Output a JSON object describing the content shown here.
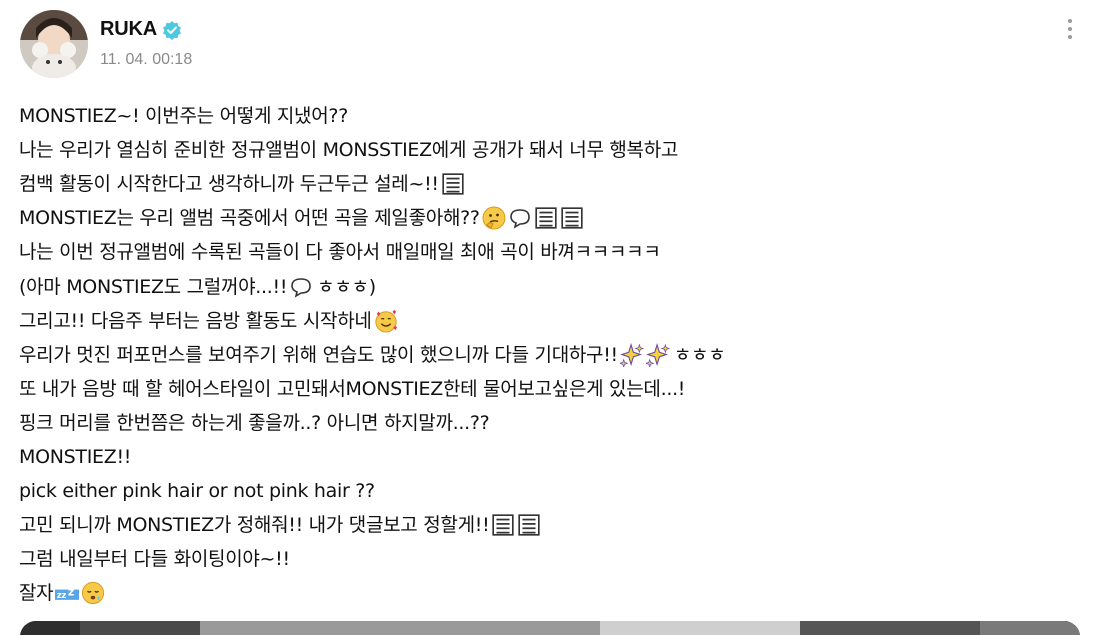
{
  "post": {
    "author": "RUKA",
    "timestamp": "11. 04. 00:18",
    "more_label": "more options"
  },
  "text_lines": [
    {
      "text": "MONSTIEZ~! 이번주는 어떻게 지냈어??",
      "icons": []
    },
    {
      "text": "나는 우리가 열심히 준비한 정규앨범이 MONSSTIEZ에게 공개가 돼서 너무 행복하고",
      "icons": []
    },
    {
      "text": "컴백 활동이 시작한다고 생각하니까 두근두근 설레~!!",
      "icons": [
        "notepad-icon"
      ]
    },
    {
      "text": "MONSTIEZ는 우리 앨범 곡중에서 어떤 곡을 제일좋아해??",
      "icons": [
        "thinking-face-icon",
        "speech-bubble-icon",
        "notepad-icon",
        "notepad-icon"
      ]
    },
    {
      "text": "나는 이번 정규앨범에 수록된 곡들이 다 좋아서 매일매일 최애 곡이 바껴ㅋㅋㅋㅋㅋ",
      "icons": []
    },
    {
      "text": "(아마 MONSTIEZ도 그럴꺼야...!!",
      "icons": [
        "speech-bubble-icon"
      ],
      "suffix": "ㅎㅎㅎ)"
    },
    {
      "text": "그리고!! 다음주 부터는 음방 활동도 시작하네",
      "icons": [
        "smiling-hearts-icon"
      ]
    },
    {
      "text": "우리가 멋진 퍼포먼스를 보여주기 위해 연습도 많이 했으니까 다들 기대하구!!",
      "icons": [
        "sparkles-icon",
        "sparkles-icon"
      ],
      "suffix": "ㅎㅎㅎ"
    },
    {
      "text": "또 내가 음방 때 할 헤어스타일이 고민돼서MONSTIEZ한테 물어보고싶은게 있는데...!",
      "icons": []
    },
    {
      "text": "핑크 머리를 한번쯤은 하는게 좋을까..? 아니면 하지말까...??",
      "icons": []
    },
    {
      "text": "MONSTIEZ!!",
      "icons": []
    },
    {
      "text": "pick either pink hair or not pink hair ??",
      "icons": []
    },
    {
      "text": "고민 되니까 MONSTIEZ가 정해줘!! 내가 댓글보고 정할게!!",
      "icons": [
        "notepad-icon",
        "notepad-icon"
      ]
    },
    {
      "text": "그럼 내일부터 다들 화이팅이야~!!",
      "icons": []
    },
    {
      "text": "잘자",
      "icons": [
        "zzz-icon",
        "sleepy-face-icon"
      ]
    }
  ]
}
